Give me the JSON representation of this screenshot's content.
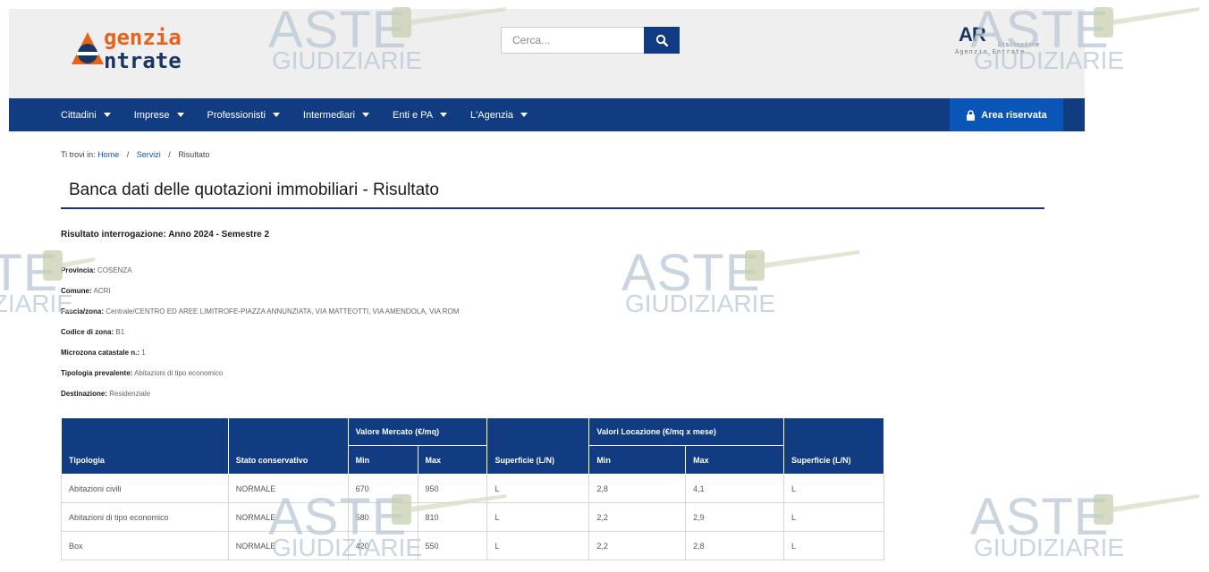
{
  "brand": {
    "logo_line1": "genzia",
    "logo_line2": "ntrate",
    "secondary_logo": "AR",
    "secondary_logo_line1": "Riscossione",
    "secondary_logo_line2": "Agenzia Entrate"
  },
  "search": {
    "placeholder": "Cerca..."
  },
  "nav": {
    "items": [
      {
        "label": "Cittadini"
      },
      {
        "label": "Imprese"
      },
      {
        "label": "Professionisti"
      },
      {
        "label": "Intermediari"
      },
      {
        "label": "Enti e PA"
      },
      {
        "label": "L'Agenzia"
      }
    ],
    "area_riservata": "Area riservata"
  },
  "breadcrumb": {
    "prefix": "Ti trovi in:",
    "home": "Home",
    "servizi": "Servizi",
    "current": "Risultato",
    "separator": "/"
  },
  "page": {
    "title": "Banca dati delle quotazioni immobiliari - Risultato",
    "result_heading": "Risultato interrogazione: Anno 2024 - Semestre 2"
  },
  "info": [
    {
      "label": "Provincia:",
      "value": "COSENZA"
    },
    {
      "label": "Comune:",
      "value": "ACRI"
    },
    {
      "label": "Fascia/zona:",
      "value": "Centrale/CENTRO ED AREE LIMITROFE-PIAZZA ANNUNZIATA, VIA MATTEOTTI, VIA AMENDOLA, VIA ROM"
    },
    {
      "label": "Codice di zona:",
      "value": "B1"
    },
    {
      "label": "Microzona catastale n.:",
      "value": "1"
    },
    {
      "label": "Tipologia prevalente:",
      "value": "Abitazioni di tipo economico"
    },
    {
      "label": "Destinazione:",
      "value": "Residenziale"
    }
  ],
  "table": {
    "headers": {
      "tipologia": "Tipologia",
      "stato": "Stato conservativo",
      "valore_mercato": "Valore Mercato (€/mq)",
      "valori_locazione": "Valori Locazione (€/mq x mese)",
      "superficie": "Superficie (L/N)",
      "min": "Min",
      "max": "Max"
    },
    "rows": [
      {
        "tipologia": "Abitazioni civili",
        "stato": "NORMALE",
        "vm_min": "670",
        "vm_max": "950",
        "sup1": "L",
        "vl_min": "2,8",
        "vl_max": "4,1",
        "sup2": "L"
      },
      {
        "tipologia": "Abitazioni di tipo economico",
        "stato": "NORMALE",
        "vm_min": "580",
        "vm_max": "810",
        "sup1": "L",
        "vl_min": "2,2",
        "vl_max": "2,9",
        "sup2": "L"
      },
      {
        "tipologia": "Box",
        "stato": "NORMALE",
        "vm_min": "420",
        "vm_max": "550",
        "sup1": "L",
        "vl_min": "2,2",
        "vl_max": "2,8",
        "sup2": "L"
      }
    ]
  },
  "watermark": {
    "line1": "ASTE",
    "line2": "GIUDIZIARIE"
  },
  "colors": {
    "nav": "#123c81",
    "accent_button": "#0a56b8",
    "logo_orange": "#e8621a",
    "logo_blue": "#1b3563"
  }
}
